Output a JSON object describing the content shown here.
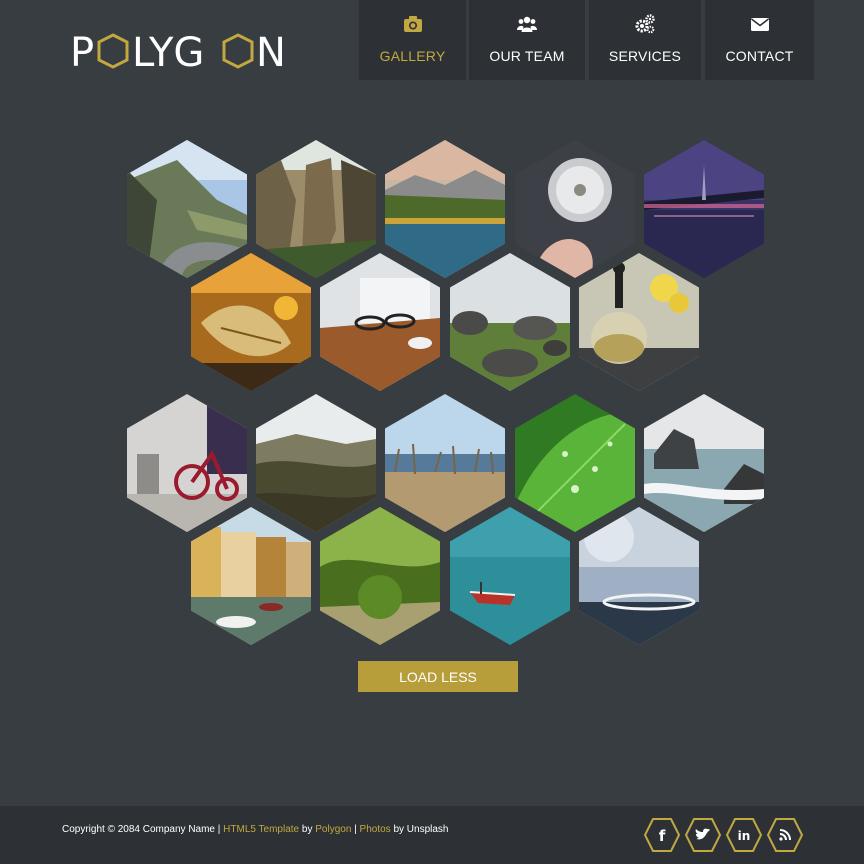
{
  "brand": {
    "name": "POLYGON",
    "accent": "#c2a840"
  },
  "nav": [
    {
      "label": "GALLERY",
      "icon": "camera-icon",
      "active": true
    },
    {
      "label": "OUR TEAM",
      "icon": "users-icon",
      "active": false
    },
    {
      "label": "SERVICES",
      "icon": "gears-icon",
      "active": false
    },
    {
      "label": "CONTACT",
      "icon": "envelope-icon",
      "active": false
    }
  ],
  "gallery": {
    "photos": [
      "mountain-road",
      "rock-cliffs",
      "lake-forest",
      "dandelion",
      "bridge-night",
      "autumn-leaves",
      "glasses-desk",
      "rocks-field",
      "teapot-flowers",
      "tricycle",
      "hills-valley",
      "dry-grass-sea",
      "leaf-droplets",
      "sea-rocks",
      "canal-houses",
      "green-forest",
      "boat-sea",
      "blur-abstract"
    ]
  },
  "load_button": {
    "label": "LOAD LESS"
  },
  "footer": {
    "copyright_prefix": "Copyright © 2084 Company Name | ",
    "template_link": "HTML5 Template",
    "by1": " by ",
    "polygon_link": "Polygon",
    "sep": " | ",
    "photos_link": "Photos",
    "by2": " by Unsplash"
  },
  "socials": [
    {
      "name": "facebook",
      "glyph": "f"
    },
    {
      "name": "twitter",
      "glyph": "t"
    },
    {
      "name": "linkedin",
      "glyph": "in"
    },
    {
      "name": "rss",
      "glyph": "rss"
    }
  ]
}
